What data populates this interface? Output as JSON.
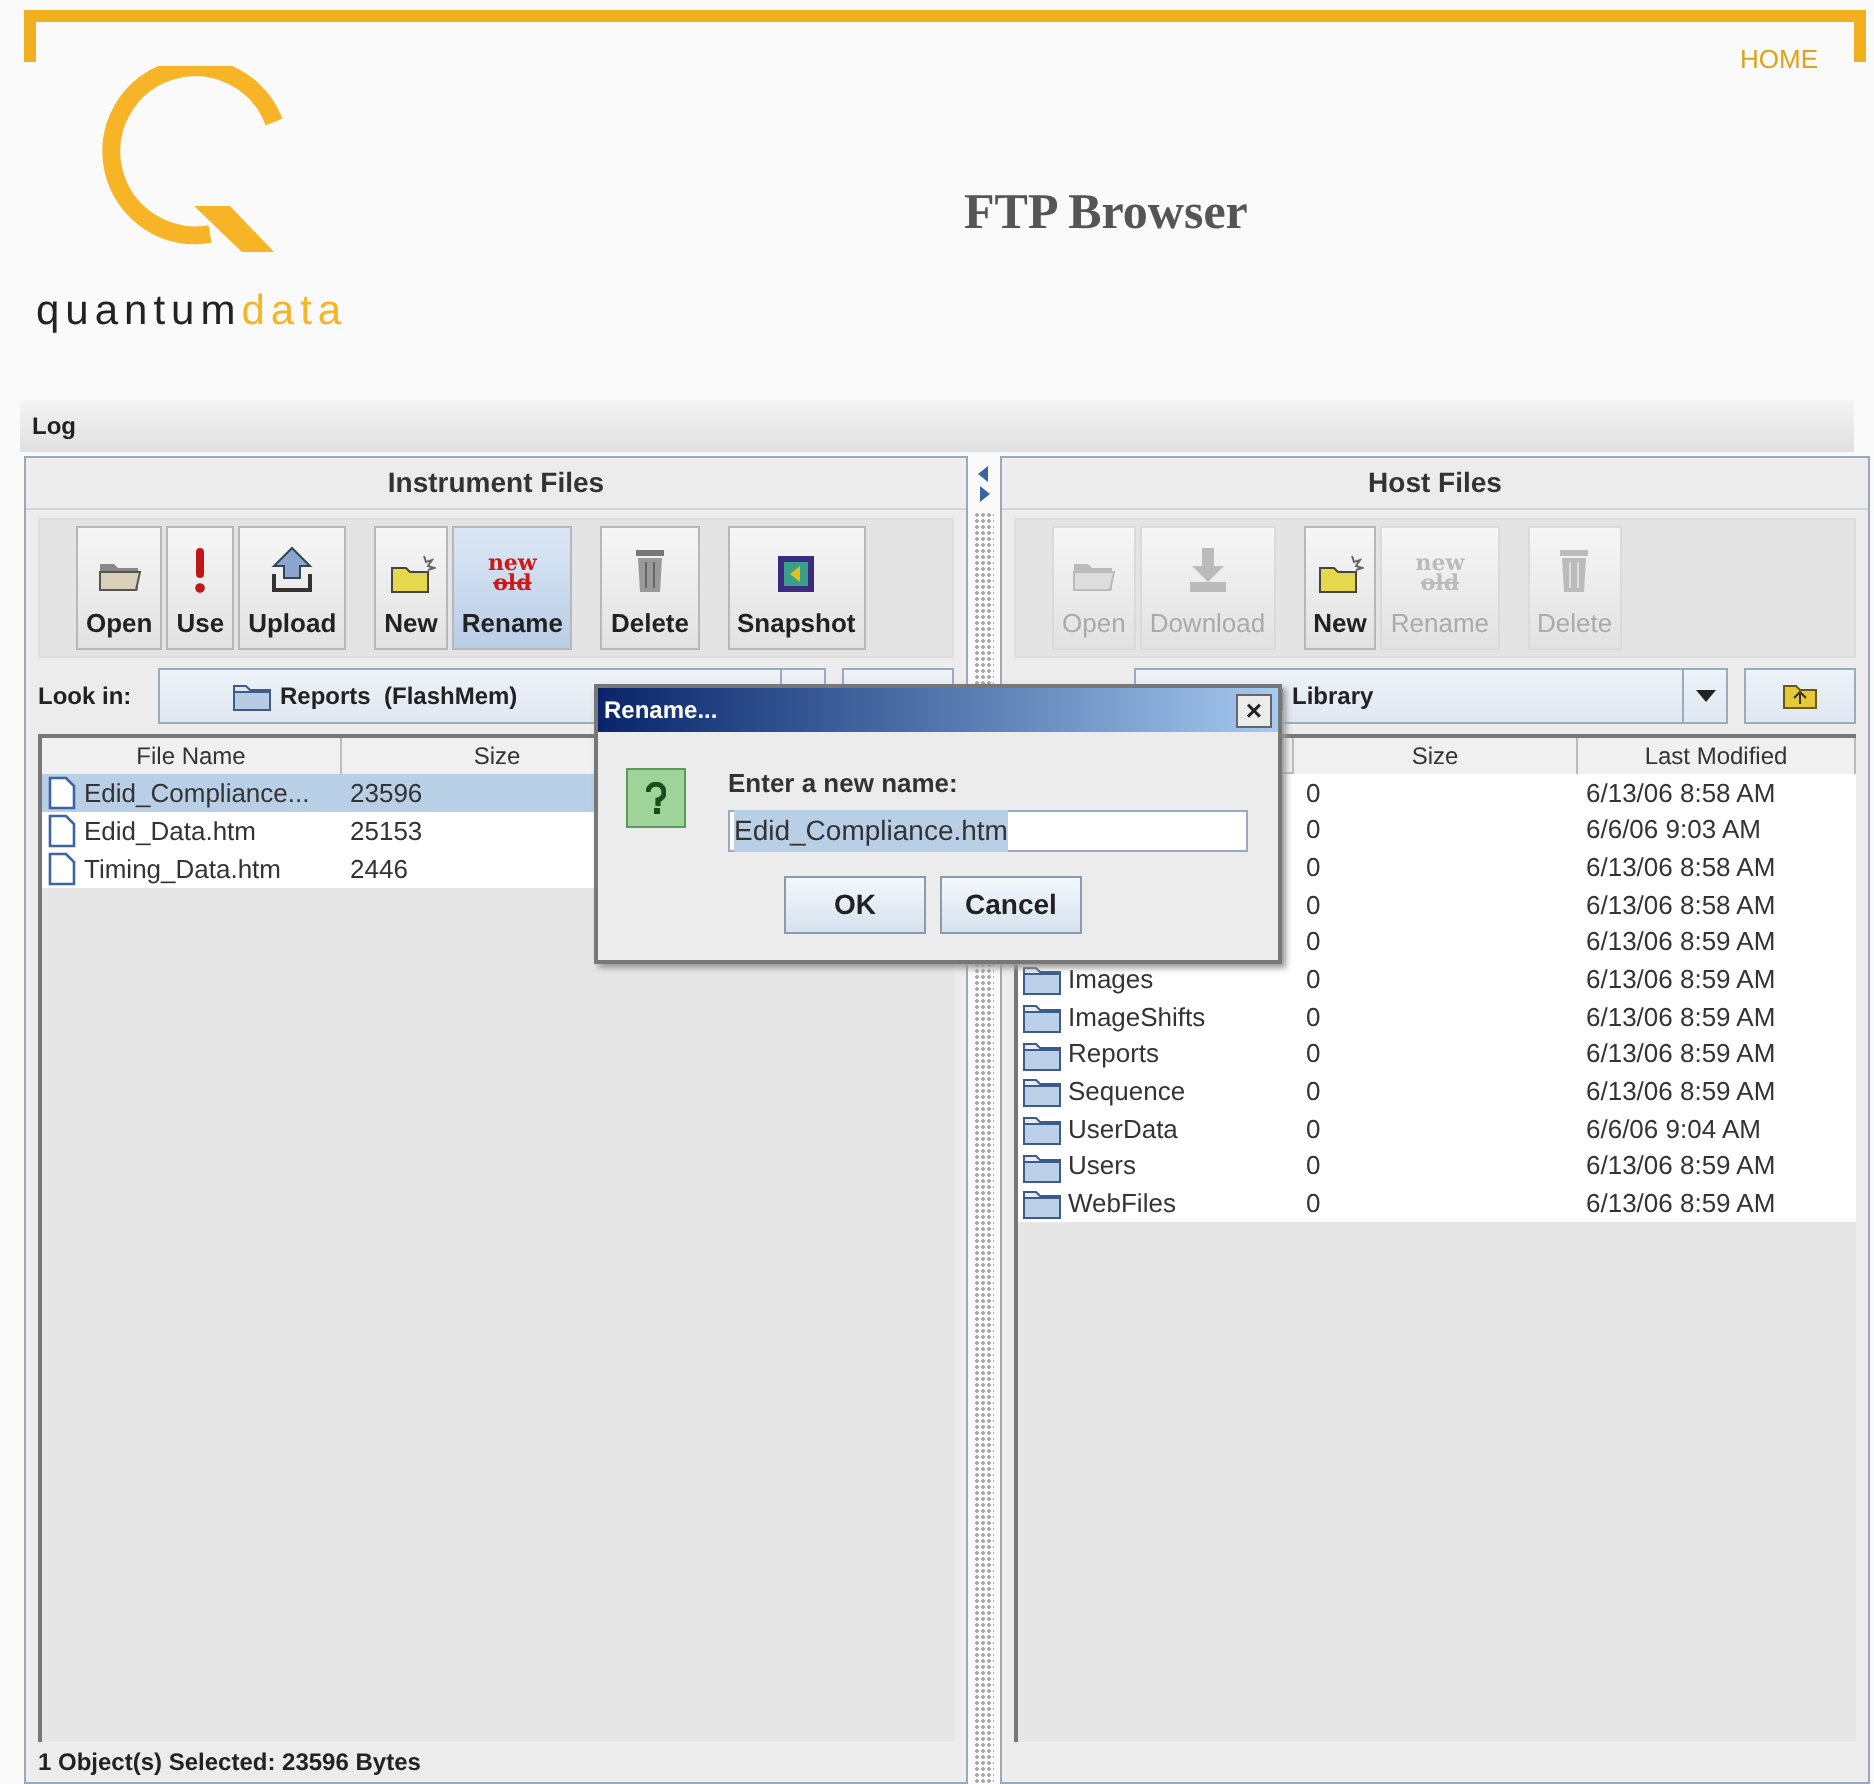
{
  "header": {
    "home_link": "HOME",
    "logo_text_dark": "quantum",
    "logo_text_light": "data",
    "title": "FTP Browser"
  },
  "log_bar": {
    "label": "Log"
  },
  "instrument_panel": {
    "title": "Instrument Files",
    "toolbar_groups": [
      [
        {
          "label": "Open",
          "kind": "folder-open",
          "disabled": false,
          "selected": false
        },
        {
          "label": "Use",
          "kind": "exclamation",
          "disabled": false,
          "selected": false
        },
        {
          "label": "Upload",
          "kind": "upload",
          "disabled": false,
          "selected": false
        }
      ],
      [
        {
          "label": "New",
          "kind": "new-folder",
          "disabled": false,
          "selected": false
        },
        {
          "label": "Rename",
          "kind": "rename",
          "icon_top": "new",
          "icon_bottom": "old",
          "disabled": false,
          "selected": true
        }
      ],
      [
        {
          "label": "Delete",
          "kind": "trash",
          "disabled": false,
          "selected": false
        }
      ],
      [
        {
          "label": "Snapshot",
          "kind": "snapshot",
          "disabled": false,
          "selected": false
        }
      ]
    ],
    "look_in_label": "Look in:",
    "location": "Reports  (FlashMem)",
    "columns": [
      "File Name",
      "Size"
    ],
    "rows": [
      {
        "name": "Edid_Compliance...",
        "size": "23596",
        "selected": true
      },
      {
        "name": "Edid_Data.htm",
        "size": "25153",
        "selected": false
      },
      {
        "name": "Timing_Data.htm",
        "size": "2446",
        "selected": false
      }
    ],
    "status": "1 Object(s) Selected:  23596 Bytes"
  },
  "host_panel": {
    "title": "Host Files",
    "toolbar_groups": [
      [
        {
          "label": "Open",
          "kind": "folder-open",
          "disabled": true,
          "selected": false
        },
        {
          "label": "Download",
          "kind": "download",
          "disabled": true,
          "selected": false
        }
      ],
      [
        {
          "label": "New",
          "kind": "new-folder",
          "disabled": false,
          "selected": false
        },
        {
          "label": "Rename",
          "kind": "rename",
          "icon_top": "new",
          "icon_bottom": "old",
          "disabled": true,
          "selected": false
        }
      ],
      [
        {
          "label": "Delete",
          "kind": "trash",
          "disabled": true,
          "selected": false
        }
      ]
    ],
    "location": "Library",
    "columns": [
      "Size",
      "Last Modified"
    ],
    "rows": [
      {
        "size": "0",
        "modified": "6/13/06 8:58 AM"
      },
      {
        "size": "0",
        "modified": "6/6/06 9:03 AM"
      },
      {
        "size": "0",
        "modified": "6/13/06 8:58 AM"
      },
      {
        "size": "0",
        "modified": "6/13/06 8:58 AM"
      },
      {
        "size": "0",
        "modified": "6/13/06 8:59 AM"
      },
      {
        "name": "Images",
        "size": "0",
        "modified": "6/13/06 8:59 AM"
      },
      {
        "name": "ImageShifts",
        "size": "0",
        "modified": "6/13/06 8:59 AM"
      },
      {
        "name": "Reports",
        "size": "0",
        "modified": "6/13/06 8:59 AM"
      },
      {
        "name": "Sequence",
        "size": "0",
        "modified": "6/13/06 8:59 AM"
      },
      {
        "name": "UserData",
        "size": "0",
        "modified": "6/6/06 9:04 AM"
      },
      {
        "name": "Users",
        "size": "0",
        "modified": "6/13/06 8:59 AM"
      },
      {
        "name": "WebFiles",
        "size": "0",
        "modified": "6/13/06 8:59 AM"
      }
    ]
  },
  "dialog": {
    "title": "Rename...",
    "close": "×",
    "prompt": "Enter a new name:",
    "value": "Edid_Compliance.htm",
    "buttons": [
      "OK",
      "Cancel"
    ]
  }
}
